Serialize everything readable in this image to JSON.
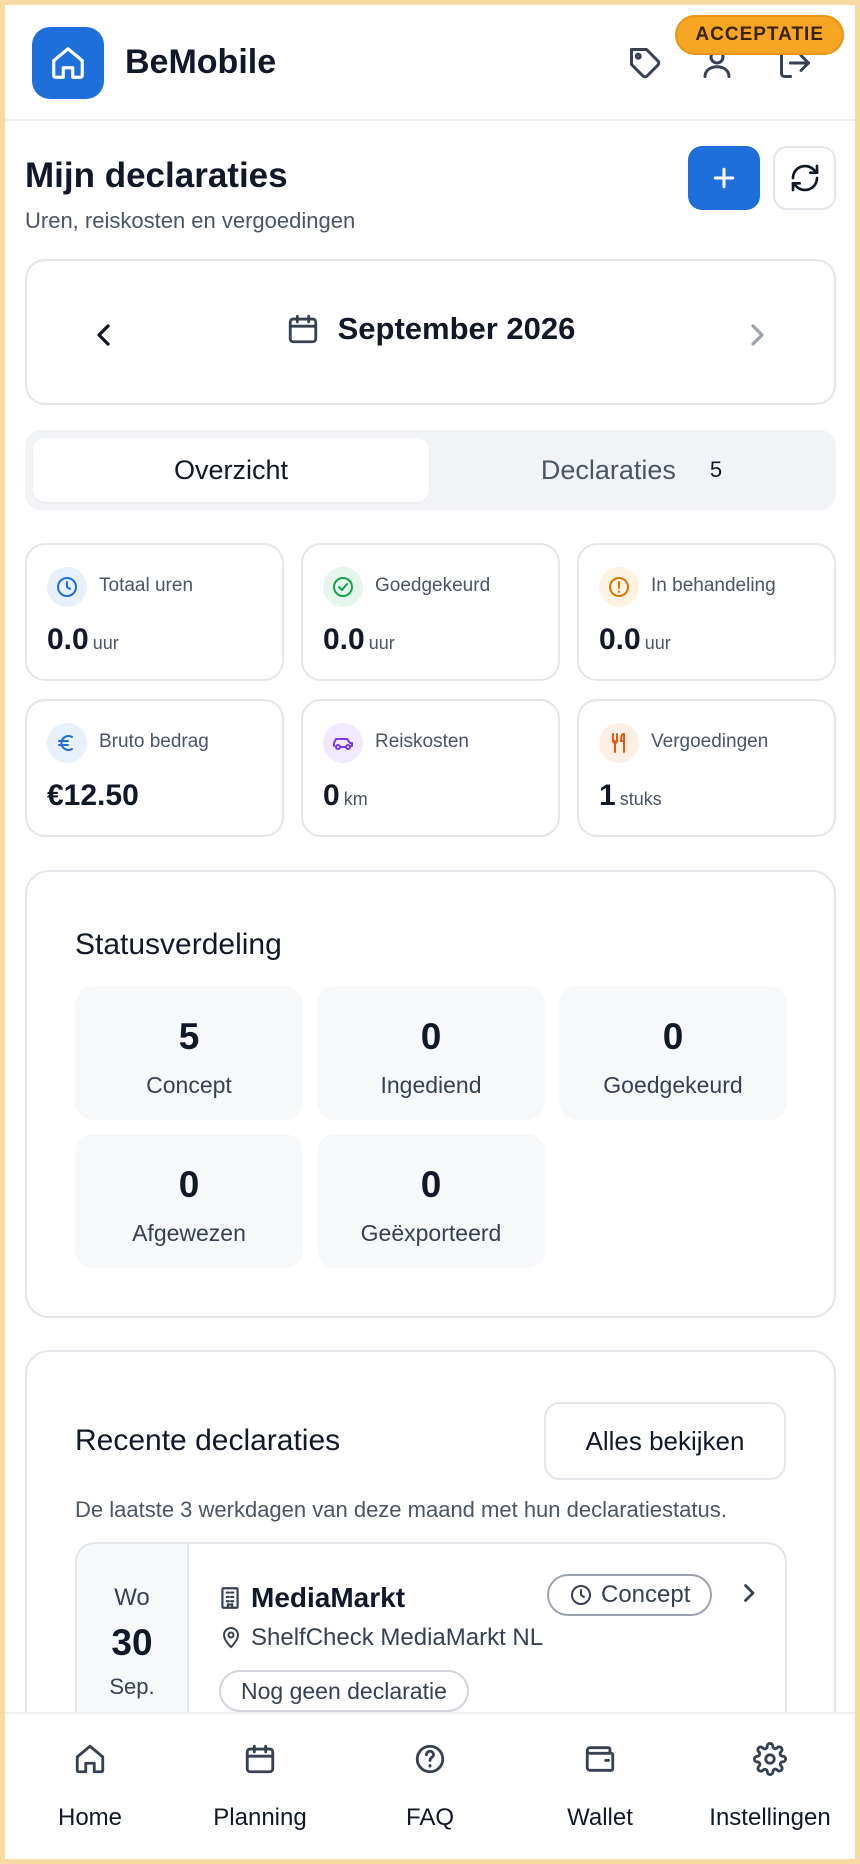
{
  "header": {
    "brand": "BeMobile",
    "env_badge": "ACCEPTATIE",
    "icons": [
      "home-icon",
      "tag-icon",
      "user-icon",
      "logout-icon"
    ]
  },
  "page": {
    "title": "Mijn declaraties",
    "subtitle": "Uren, reiskosten en vergoedingen"
  },
  "month": {
    "label": "September 2026"
  },
  "tabs": [
    {
      "label": "Overzicht",
      "active": true
    },
    {
      "label": "Declaraties",
      "count": "5",
      "active": false
    }
  ],
  "stats": [
    {
      "label": "Totaal uren",
      "value": "0.0",
      "unit": "uur",
      "icon": "clock-icon",
      "color": "#1e6fd9"
    },
    {
      "label": "Goedgekeurd",
      "value": "0.0",
      "unit": "uur",
      "icon": "check-circle-icon",
      "color": "#16a34a"
    },
    {
      "label": "In behandeling",
      "value": "0.0",
      "unit": "uur",
      "icon": "alert-circle-icon",
      "color": "#d97706"
    },
    {
      "label": "Bruto bedrag",
      "value": "€12.50",
      "unit": "",
      "icon": "euro-icon",
      "color": "#1e6fd9"
    },
    {
      "label": "Reiskosten",
      "value": "0",
      "unit": "km",
      "icon": "car-icon",
      "color": "#7c3aed"
    },
    {
      "label": "Vergoedingen",
      "value": "1",
      "unit": "stuks",
      "icon": "utensils-icon",
      "color": "#ea580c"
    }
  ],
  "status": {
    "title": "Statusverdeling",
    "items": [
      {
        "count": "5",
        "label": "Concept"
      },
      {
        "count": "0",
        "label": "Ingediend"
      },
      {
        "count": "0",
        "label": "Goedgekeurd"
      },
      {
        "count": "0",
        "label": "Afgewezen"
      },
      {
        "count": "0",
        "label": "Geëxporteerd"
      }
    ]
  },
  "recent": {
    "title": "Recente declaraties",
    "view_all": "Alles bekijken",
    "description": "De laatste 3 werkdagen van deze maand met hun declaratiestatus.",
    "items": [
      {
        "dow": "Wo",
        "day": "30",
        "month": "Sep.",
        "name": "MediaMarkt",
        "location": "ShelfCheck MediaMarkt NL",
        "status": "Concept",
        "note": "Nog geen declaratie"
      }
    ]
  },
  "nav": [
    {
      "label": "Home",
      "icon": "home-icon"
    },
    {
      "label": "Planning",
      "icon": "calendar-icon"
    },
    {
      "label": "FAQ",
      "icon": "help-circle-icon"
    },
    {
      "label": "Wallet",
      "icon": "wallet-icon"
    },
    {
      "label": "Instellingen",
      "icon": "gear-icon"
    }
  ],
  "colors": {
    "primary": "#1e6fd9",
    "badge": "#f6a623",
    "border": "#e3e6eb"
  }
}
